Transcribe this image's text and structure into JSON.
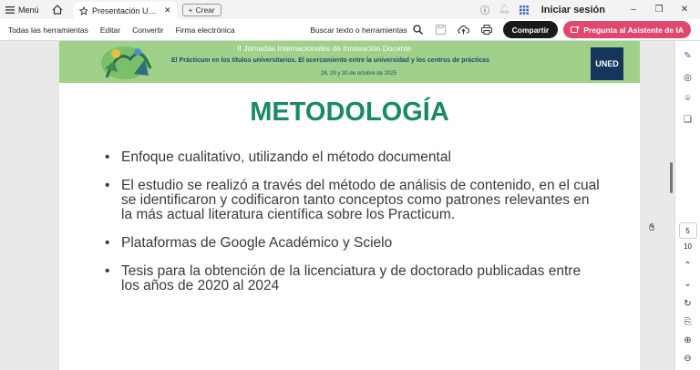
{
  "titlebar": {
    "menu_label": "Menú",
    "tab_title": "Presentación UNED....",
    "create_label": "Crear",
    "login_label": "Iniciar sesión"
  },
  "toolbar": {
    "all_tools": "Todas las herramientas",
    "edit": "Editar",
    "convert": "Convertir",
    "esign": "Firma electrónica",
    "search_tools": "Buscar texto o herramientas",
    "share": "Compartir",
    "ai_assistant": "Pregunta al Asistente de IA"
  },
  "banner": {
    "line1": "II Jornadas Internacionales de Innovación Docente",
    "line2": "El Prácticum en los títulos universitarios. El acercamiento entre la universidad y los centros de prácticas",
    "line3": "28, 29 y 30 de octubre de 2025",
    "logo": "UNED"
  },
  "slide": {
    "title": "METODOLOGÍA",
    "bullets": [
      "Enfoque cualitativo, utilizando el método documental",
      "El estudio se realizó a través del método de análisis de contenido, en el cual se identificaron y codificaron tanto conceptos como patrones relevantes en la más actual literatura científica sobre los Practicum.",
      "Plataformas de Google Académico y Scielo",
      "Tesis para la obtención de la licenciatura y de doctorado  publicadas entre los años de 2020 al 2024"
    ]
  },
  "pager": {
    "current": "5",
    "total": "10"
  },
  "colors": {
    "heading": "#1a8a60",
    "banner": "#9fd18b",
    "ai_button": "#e0466e"
  }
}
